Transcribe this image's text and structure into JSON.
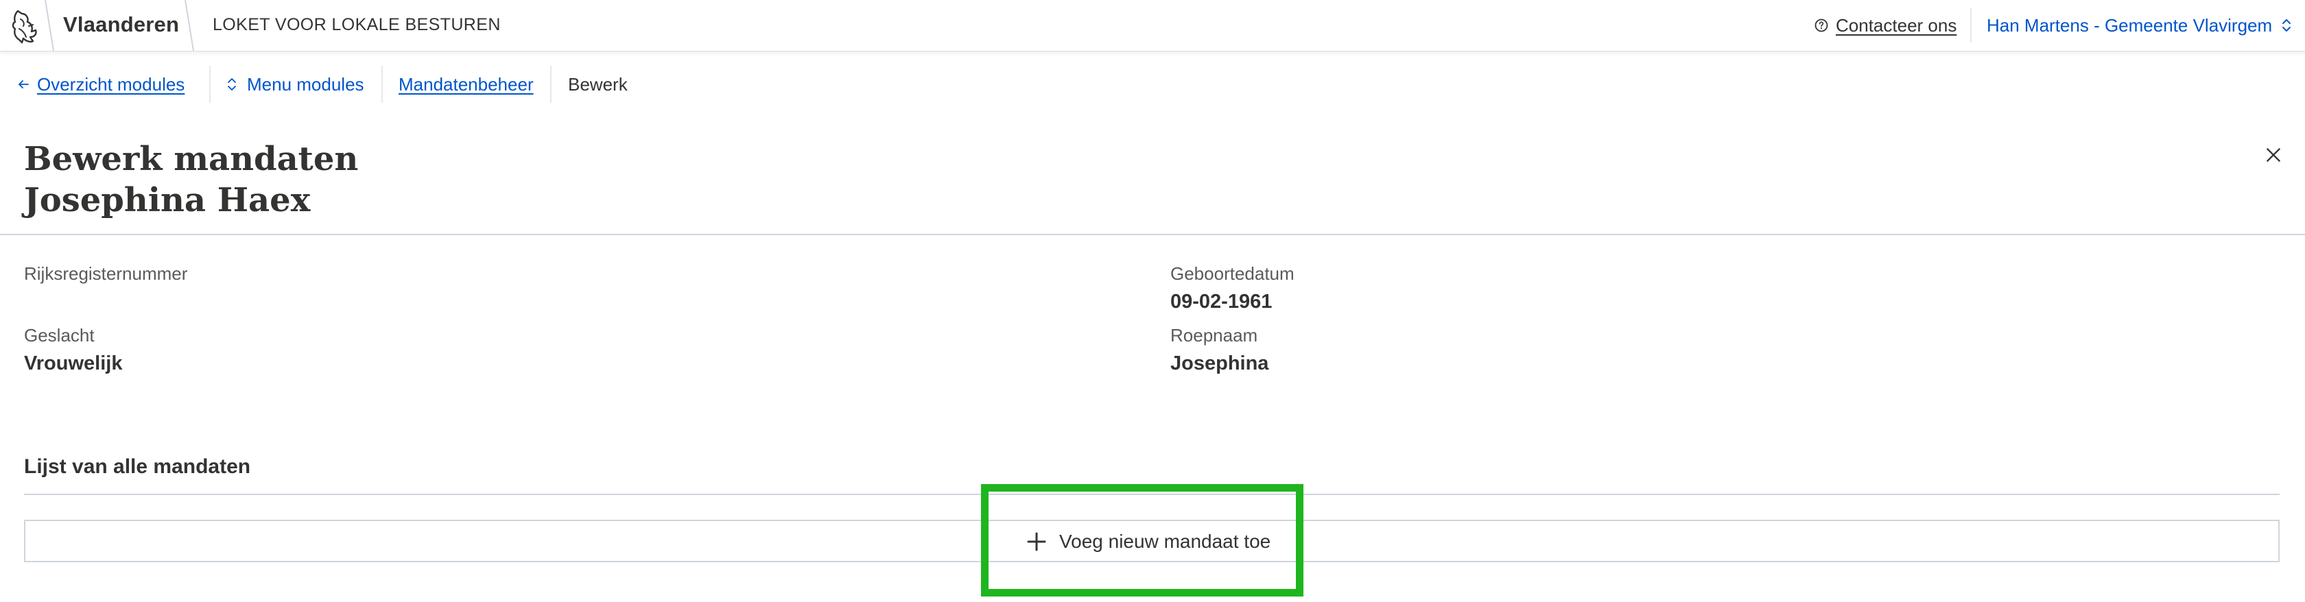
{
  "header": {
    "brand": "Vlaanderen",
    "app_title": "LOKET VOOR LOKALE BESTUREN",
    "contact_label": "Contacteer ons",
    "user_label": "Han Martens - Gemeente Vlavirgem",
    "icons": {
      "logo": "flemish-lion-logo",
      "contact": "help-circle-icon",
      "user_switch": "chevron-up-down-icon"
    }
  },
  "nav": {
    "overview_label": "Overzicht modules",
    "menu_label": "Menu modules",
    "module_label": "Mandatenbeheer",
    "current_label": "Bewerk"
  },
  "page": {
    "title_line1": "Bewerk mandaten",
    "title_line2": "Josephina Haex"
  },
  "person": {
    "rrn_label": "Rijksregisternummer",
    "rrn_value": "",
    "birth_label": "Geboortedatum",
    "birth_value": "09-02-1961",
    "gender_label": "Geslacht",
    "gender_value": "Vrouwelijk",
    "callname_label": "Roepnaam",
    "callname_value": "Josephina"
  },
  "mandaten": {
    "section_title": "Lijst van alle mandaten",
    "add_label": "Voeg nieuw mandaat toe"
  },
  "colors": {
    "link": "#0055cc",
    "text": "#333332",
    "highlight": "#1fb51f",
    "border": "#cfd5dd"
  }
}
